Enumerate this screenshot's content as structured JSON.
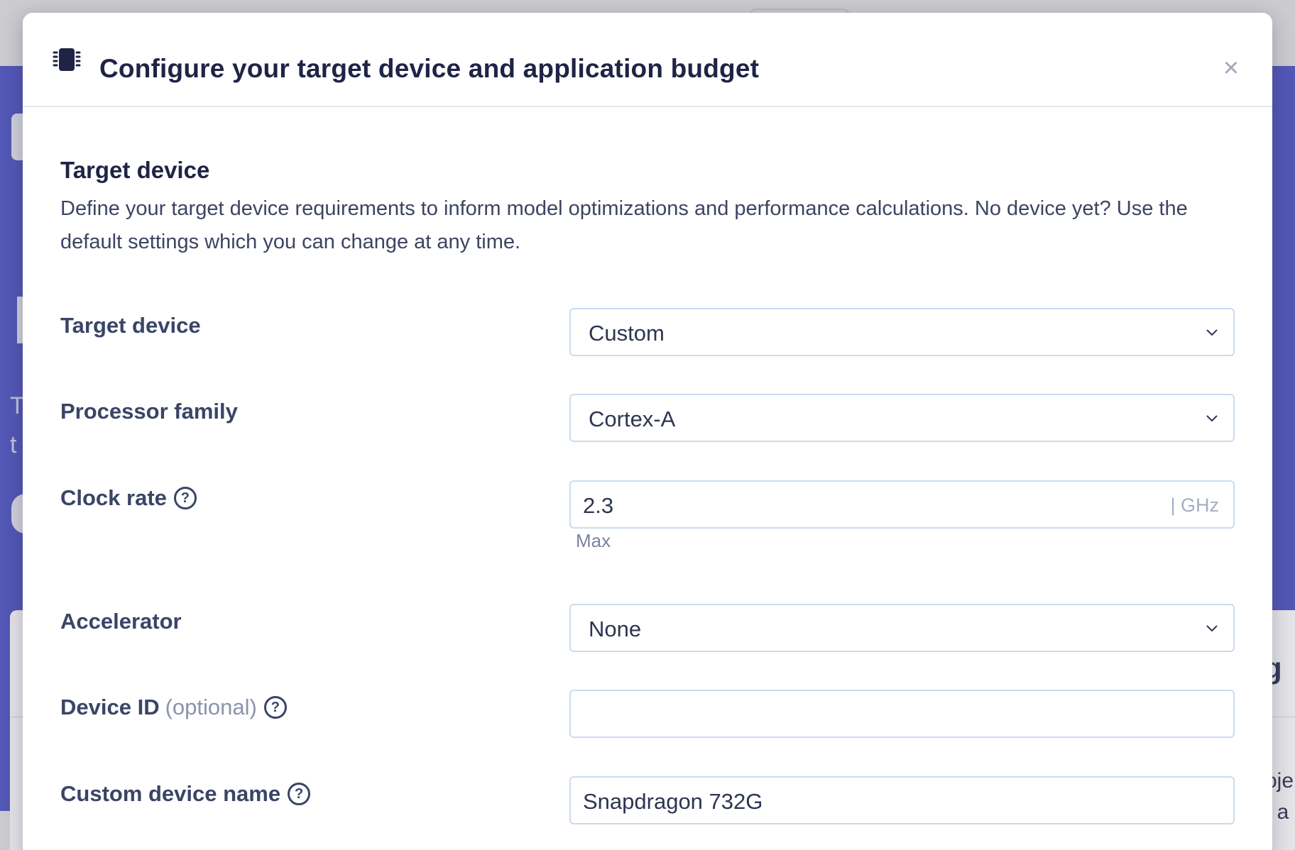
{
  "background": {
    "frag_t1": "T",
    "frag_t2": "t",
    "frag_g": "g",
    "frag_oje": "oje",
    "frag_ta": "t a"
  },
  "modal": {
    "title": "Configure your target device and application budget",
    "close_symbol": "×",
    "icon": "chip-icon"
  },
  "section": {
    "title": "Target device",
    "description": "Define your target device requirements to inform model optimizations and performance calculations. No device yet? Use the default settings which you can change at any time."
  },
  "fields": {
    "target_device": {
      "label": "Target device",
      "value": "Custom"
    },
    "processor_family": {
      "label": "Processor family",
      "value": "Cortex-A"
    },
    "clock_rate": {
      "label": "Clock rate",
      "value": "2.3",
      "unit": "| GHz",
      "hint": "Max"
    },
    "accelerator": {
      "label": "Accelerator",
      "value": "None"
    },
    "device_id": {
      "label": "Device ID",
      "optional": "(optional)",
      "value": ""
    },
    "custom_device_name": {
      "label": "Custom device name",
      "value": "Snapdragon 732G"
    }
  },
  "icons": {
    "help": "?"
  },
  "colors": {
    "accent_band": "#5b5fc7",
    "title": "#1f2446",
    "input_border": "#cbdcf0"
  }
}
